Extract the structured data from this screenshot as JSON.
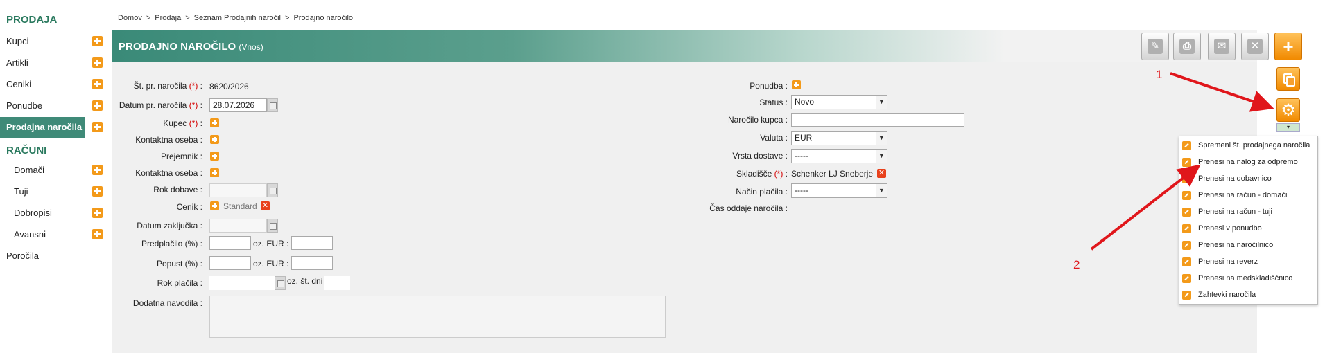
{
  "sidebar": {
    "section_sales": "PRODAJA",
    "items_sales": [
      {
        "label": "Kupci"
      },
      {
        "label": "Artikli"
      },
      {
        "label": "Ceniki"
      },
      {
        "label": "Ponudbe"
      },
      {
        "label": "Prodajna naročila"
      }
    ],
    "section_invoices": "RAČUNI",
    "items_invoices": [
      {
        "label": "Domači"
      },
      {
        "label": "Tuji"
      },
      {
        "label": "Dobropisi"
      },
      {
        "label": "Avansni"
      }
    ],
    "reports": "Poročila"
  },
  "breadcrumb": [
    "Domov",
    "Prodaja",
    "Seznam Prodajnih naročil",
    "Prodajno naročilo"
  ],
  "breadcrumb_sep": ">",
  "header": {
    "title": "PRODAJNO NAROČILO",
    "subtitle": "(Vnos)"
  },
  "required_mark": "(*)",
  "form_left": {
    "order_no_label": "Št. pr. naročila",
    "order_no_value": "8620/2026",
    "order_date_label": "Datum pr. naročila",
    "order_date_value": "28.07.2026",
    "customer_label": "Kupec",
    "contact_label": "Kontaktna oseba",
    "recipient_label": "Prejemnik",
    "contact2_label": "Kontaktna oseba",
    "delivery_label": "Rok dobave :",
    "pricelist_label": "Cenik :",
    "pricelist_value": "Standard",
    "close_date_label": "Datum zaključka :",
    "prepay_label": "Predplačilo (%) :",
    "prepay_eur_label": "oz. EUR :",
    "discount_label": "Popust (%) :",
    "discount_eur_label": "oz. EUR :",
    "payment_term_label": "Rok plačila :",
    "payment_days_label": "oz. št. dni",
    "notes_label": "Dodatna navodila :"
  },
  "form_right": {
    "offer_label": "Ponudba :",
    "status_label": "Status :",
    "status_value": "Novo",
    "customer_order_label": "Naročilo kupca :",
    "currency_label": "Valuta :",
    "currency_value": "EUR",
    "delivery_type_label": "Vrsta dostave :",
    "delivery_type_value": "-----",
    "warehouse_label": "Skladišče",
    "warehouse_value": "Schenker LJ Sneberje",
    "payment_method_label": "Način plačila :",
    "payment_method_value": "-----",
    "submit_time_label": "Čas oddaje naročila :"
  },
  "toolbar_icons": [
    "edit-icon",
    "print-icon",
    "mail-icon",
    "close-icon",
    "add-icon"
  ],
  "dropdown_items": [
    "Spremeni št. prodajnega naročila",
    "Prenesi na nalog za odpremo",
    "Prenesi na dobavnico",
    "Prenesi na račun - domači",
    "Prenesi na račun - tuji",
    "Prenesi v ponudbo",
    "Prenesi na naročilnico",
    "Prenesi na reverz",
    "Prenesi na medskladiščnico",
    "Zahtevki naročila"
  ],
  "annotations": {
    "one": "1",
    "two": "2"
  },
  "colors": {
    "accent": "#3f8a78",
    "orange": "#f39a1a",
    "annotation": "#e0161b"
  }
}
